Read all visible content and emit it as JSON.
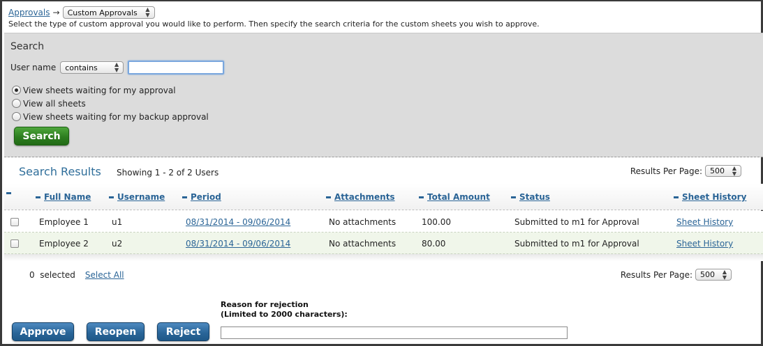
{
  "breadcrumb": {
    "root_link": "Approvals",
    "arrow": "→",
    "type_select": "Custom Approvals"
  },
  "intro_text": "Select the type of custom approval you would like to perform. Then specify the search criteria for the custom sheets you wish to approve.",
  "search": {
    "title": "Search",
    "username_label": "User name",
    "operator_select": "contains",
    "username_value": "",
    "options": [
      {
        "label": "View sheets waiting for my approval",
        "checked": true
      },
      {
        "label": "View all sheets",
        "checked": false
      },
      {
        "label": "View sheets waiting for my backup approval",
        "checked": false
      }
    ],
    "search_button": "Search"
  },
  "results": {
    "title": "Search Results",
    "showing": "Showing 1 - 2 of 2 Users",
    "rpp_label": "Results Per Page:",
    "rpp_value": "500",
    "columns": [
      "Full Name",
      "Username",
      "Period",
      "Attachments",
      "Total Amount",
      "Status",
      "Sheet History"
    ],
    "rows": [
      {
        "full_name": "Employee 1",
        "username": "u1",
        "period": "08/31/2014 - 09/06/2014",
        "attachments": "No attachments",
        "total": "100.00",
        "status": "Submitted to m1 for Approval",
        "history": "Sheet History"
      },
      {
        "full_name": "Employee 2",
        "username": "u2",
        "period": "08/31/2014 - 09/06/2014",
        "attachments": "No attachments",
        "total": "80.00",
        "status": "Submitted to m1 for Approval",
        "history": "Sheet History"
      }
    ]
  },
  "selection": {
    "count": "0  selected",
    "select_all": "Select All",
    "rpp_label": "Results Per Page:",
    "rpp_value": "500"
  },
  "reason": {
    "label_line1": "Reason for rejection",
    "label_line2": "(Limited to 2000 characters):",
    "value": ""
  },
  "actions": {
    "approve": "Approve",
    "reopen": "Reopen",
    "reject": "Reject"
  }
}
